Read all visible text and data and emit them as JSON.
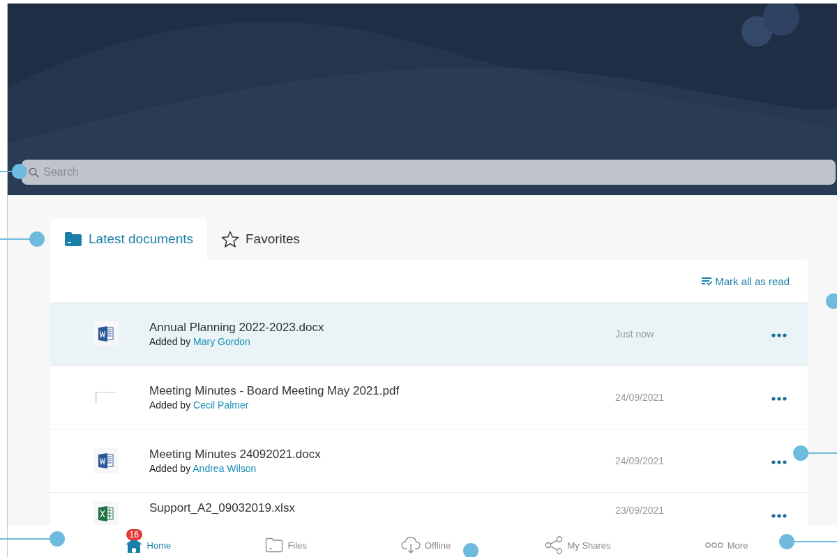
{
  "search": {
    "placeholder": "Search"
  },
  "tabs": [
    {
      "label": "Latest documents",
      "selected": true,
      "kind": "folder"
    },
    {
      "label": "Favorites",
      "selected": false,
      "kind": "star"
    }
  ],
  "toolbar": {
    "action": "Mark all as read"
  },
  "documents": [
    {
      "name": "Annual Planning 2022-2023.docx",
      "added_by": "Added by",
      "author": "Mary Gordon",
      "date": "Just now",
      "kind": "word",
      "selected": true
    },
    {
      "name": "Meeting Minutes - Board Meeting May 2021.pdf",
      "added_by": "Added by",
      "author": "Cecil Palmer",
      "date": "24/09/2021",
      "kind": "pdf",
      "selected": false
    },
    {
      "name": "Meeting Minutes 24092021.docx",
      "added_by": "Added by",
      "author": "Andrea Wilson",
      "date": "24/09/2021",
      "kind": "word",
      "selected": false
    },
    {
      "name": "Support_A2_09032019.xlsx",
      "date": "23/09/2021",
      "kind": "excel",
      "selected": false
    }
  ],
  "bottom_nav": [
    {
      "label": "Home",
      "kind": "home",
      "selected": true,
      "badge": "16"
    },
    {
      "label": "Files",
      "kind": "folder",
      "selected": false
    },
    {
      "label": "Offline",
      "kind": "cloud",
      "selected": false
    },
    {
      "label": "My Shares",
      "kind": "share",
      "selected": false
    },
    {
      "label": "More",
      "kind": "more",
      "selected": false
    }
  ]
}
